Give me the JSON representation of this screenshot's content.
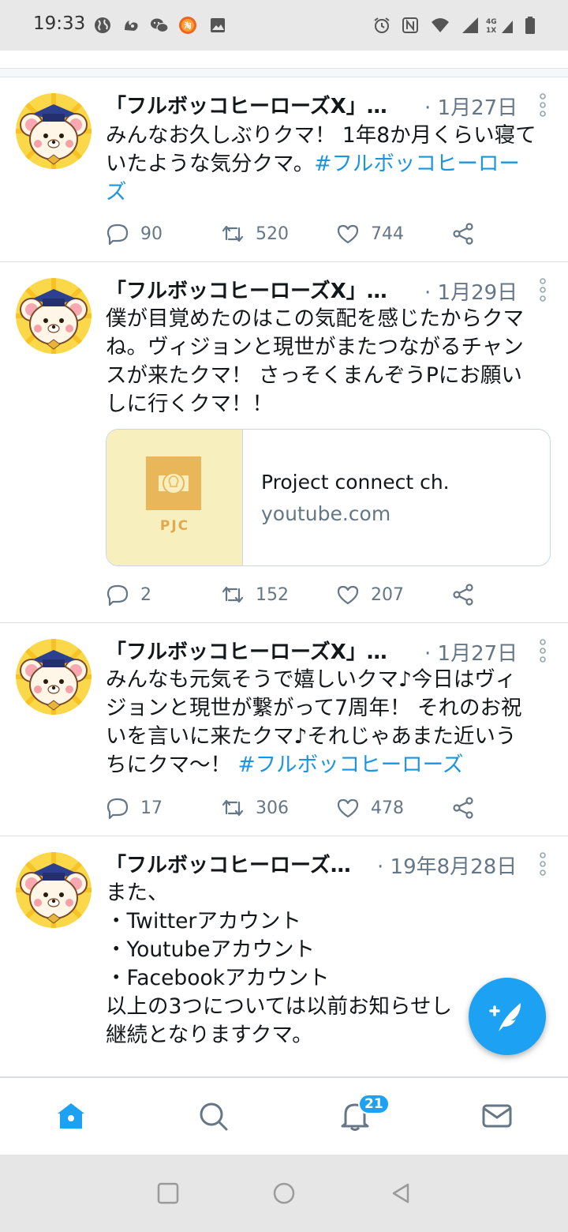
{
  "status_bar": {
    "time": "19:33",
    "left_icons": [
      "globe-icon",
      "uc-browser-icon",
      "wechat-icon",
      "taobao-icon",
      "image-icon"
    ],
    "right_icons": [
      "alarm-icon",
      "nfc-icon",
      "wifi-icon",
      "signal-icon",
      "battery-icon"
    ],
    "network_label_top": "4G",
    "network_label_bottom": "1X"
  },
  "tweets": [
    {
      "name": "「フルボッコヒーローズX」…",
      "date": "· 1月27日",
      "lines": [
        [
          {
            "t": "みんなお久しぶりクマ！ 1年8か月くらい寝て"
          }
        ],
        [
          {
            "t": "いたような気分クマ。"
          },
          {
            "t": "#フルボッコヒーロー",
            "tag": true
          }
        ],
        [
          {
            "t": "ズ",
            "tag": true
          }
        ]
      ],
      "replies": "90",
      "retweets": "520",
      "likes": "744"
    },
    {
      "name": "「フルボッコヒーローズX」…",
      "date": "· 1月29日",
      "lines": [
        [
          {
            "t": "僕が目覚めたのはこの気配を感じたからクマ"
          }
        ],
        [
          {
            "t": "ね。ヴィジョンと現世がまたつながるチャン"
          }
        ],
        [
          {
            "t": "スが来たクマ！ さっそくまんぞうPにお願い"
          }
        ],
        [
          {
            "t": "しに行くクマ！！"
          }
        ]
      ],
      "card": {
        "thumb_label": "PJC",
        "title": "Project connect ch.",
        "domain": "youtube.com"
      },
      "replies": "2",
      "retweets": "152",
      "likes": "207"
    },
    {
      "name": "「フルボッコヒーローズX」…",
      "date": "· 1月27日",
      "lines": [
        [
          {
            "t": "みんなも元気そうで嬉しいクマ♪今日はヴィ"
          }
        ],
        [
          {
            "t": "ジョンと現世が繋がって7周年！ それのお祝"
          }
        ],
        [
          {
            "t": "いを言いに来たクマ♪それじゃあまた近いう"
          }
        ],
        [
          {
            "t": "ちにクマ～！ "
          },
          {
            "t": "#フルボッコヒーローズ",
            "tag": true
          }
        ]
      ],
      "replies": "17",
      "retweets": "306",
      "likes": "478"
    },
    {
      "name": "「フルボッコヒーローズ…",
      "date": "· 19年8月28日",
      "lines": [
        [
          {
            "t": "また、"
          }
        ],
        [
          {
            "t": "・Twitterアカウント"
          }
        ],
        [
          {
            "t": "・Youtubeアカウント"
          }
        ],
        [
          {
            "t": "・Facebookアカウント"
          }
        ],
        [
          {
            "t": "以上の3つについては以前お知らせし"
          }
        ],
        [
          {
            "t": "継続となりますクマ。"
          }
        ]
      ]
    }
  ],
  "fab": {
    "icon": "compose-tweet-icon"
  },
  "bottom_nav": {
    "items": [
      "home-icon",
      "search-icon",
      "notifications-icon",
      "messages-icon"
    ],
    "notification_badge": "21"
  },
  "system_nav": [
    "recents-button",
    "home-button",
    "back-button"
  ],
  "colors": {
    "accent": "#1da1f2",
    "hashtag": "#1b95e0",
    "secondary_text": "#657786",
    "card_thumb_bg": "#f8efbe",
    "card_logo": "#eab65a"
  }
}
